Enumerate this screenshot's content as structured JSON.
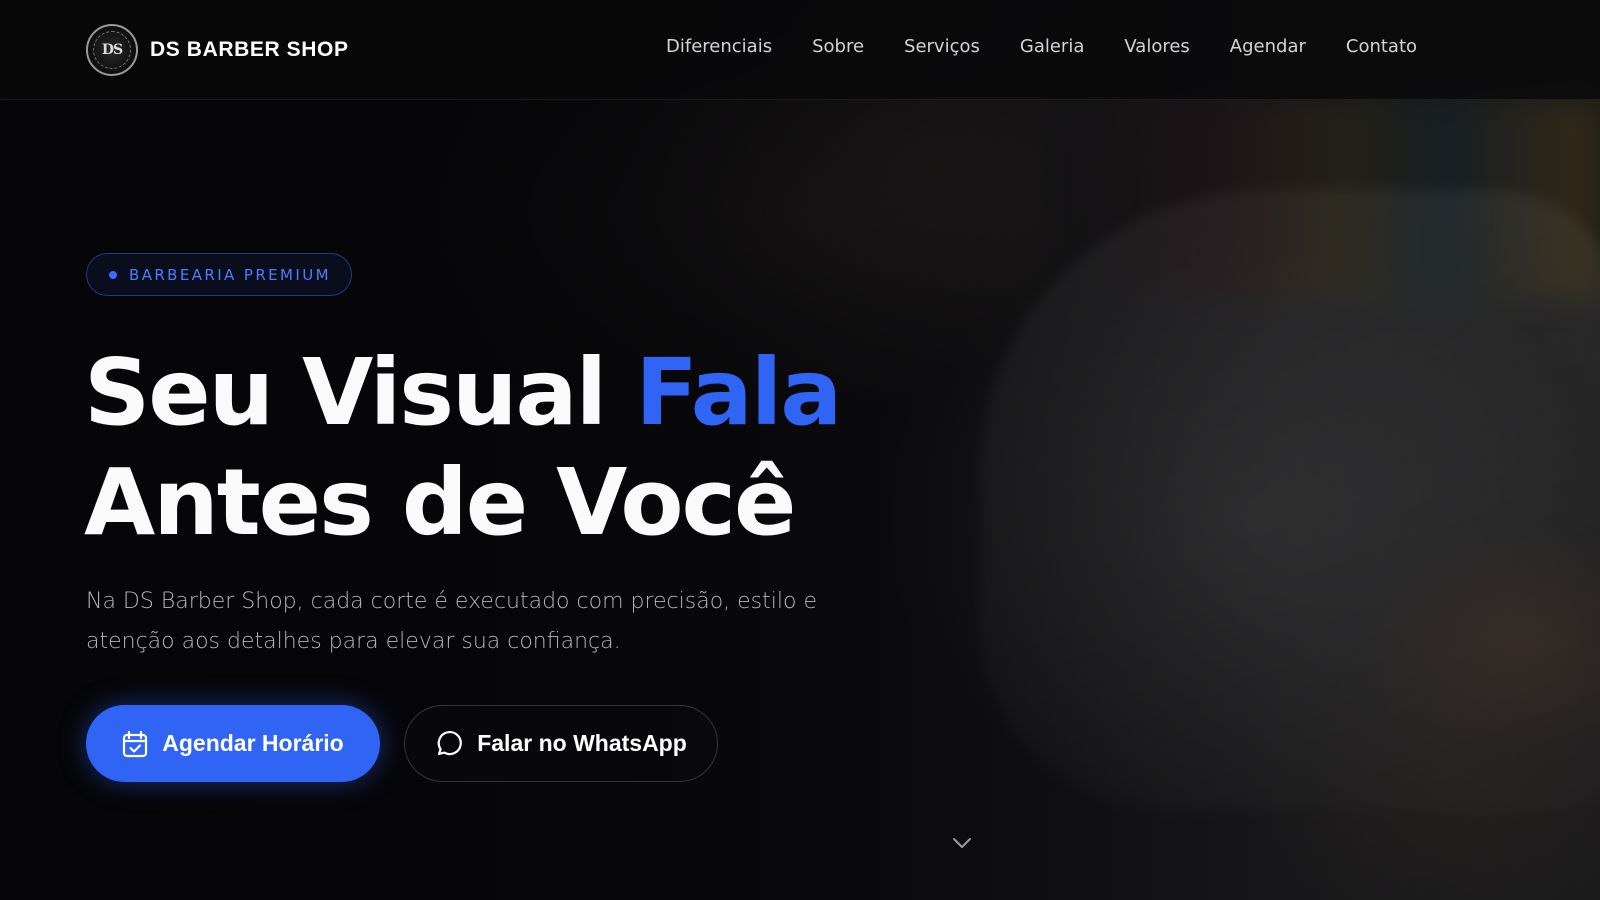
{
  "brand": {
    "logo_text": "DS",
    "name": "DS BARBER SHOP"
  },
  "nav": {
    "items": [
      {
        "label": "Diferenciais"
      },
      {
        "label": "Sobre"
      },
      {
        "label": "Serviços"
      },
      {
        "label": "Galeria"
      },
      {
        "label": "Valores"
      },
      {
        "label": "Agendar"
      },
      {
        "label": "Contato"
      }
    ]
  },
  "hero": {
    "badge": "BARBEARIA PREMIUM",
    "title_part1": "Seu Visual ",
    "title_accent": "Fala",
    "title_line2": "Antes de Você",
    "subtitle_line1": "Na DS Barber Shop, cada corte é executado com precisão, estilo e",
    "subtitle_line2": "atenção aos detalhes para elevar sua confiança.",
    "primary_button": "Agendar Horário",
    "secondary_button": "Falar no WhatsApp"
  },
  "icons": {
    "primary_button_icon": "calendar-check-icon",
    "secondary_button_icon": "message-circle-icon",
    "scroll_icon": "chevron-down-icon"
  },
  "colors": {
    "accent": "#2f64f5",
    "background": "#0b0b0d",
    "badge_text": "#4f7cff"
  }
}
